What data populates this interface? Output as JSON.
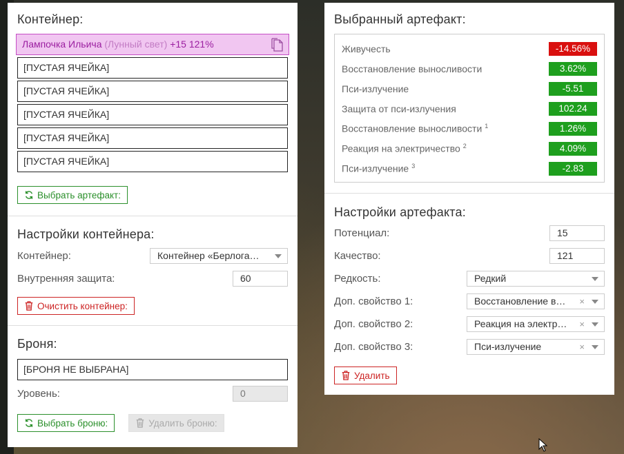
{
  "container": {
    "title": "Контейнер:",
    "artifact_name": "Лампочка Ильича",
    "artifact_sub": "(Лунный свет)",
    "artifact_stats": "+15 121%",
    "empty_cells": [
      "[ПУСТАЯ ЯЧЕЙКА]",
      "[ПУСТАЯ ЯЧЕЙКА]",
      "[ПУСТАЯ ЯЧЕЙКА]",
      "[ПУСТАЯ ЯЧЕЙКА]",
      "[ПУСТАЯ ЯЧЕЙКА]"
    ],
    "select_artifact_label": "Выбрать артефакт:"
  },
  "container_settings": {
    "title": "Настройки контейнера:",
    "container_label": "Контейнер:",
    "container_value": "Контейнер «Берлога…",
    "protection_label": "Внутренняя защита:",
    "protection_value": "60",
    "clear_label": "Очистить контейнер:"
  },
  "armor": {
    "title": "Броня:",
    "cell": "[БРОНЯ НЕ ВЫБРАНА]",
    "level_label": "Уровень:",
    "level_value": "0",
    "select_label": "Выбрать броню:",
    "delete_label": "Удалить броню:"
  },
  "selected_artifact": {
    "title": "Выбранный артефакт:",
    "stats": [
      {
        "name": "Живучесть",
        "sup": "",
        "value": "-14.56%",
        "status": "bad"
      },
      {
        "name": "Восстановление выносливости",
        "sup": "",
        "value": "3.62%",
        "status": "good"
      },
      {
        "name": "Пси-излучение",
        "sup": "",
        "value": "-5.51",
        "status": "good"
      },
      {
        "name": "Защита от пси-излучения",
        "sup": "",
        "value": "102.24",
        "status": "good"
      },
      {
        "name": "Восстановление выносливости",
        "sup": "1",
        "value": "1.26%",
        "status": "good"
      },
      {
        "name": "Реакция на электричество",
        "sup": "2",
        "value": "4.09%",
        "status": "good"
      },
      {
        "name": "Пси-излучение",
        "sup": "3",
        "value": "-2.83",
        "status": "good"
      }
    ]
  },
  "artifact_settings": {
    "title": "Настройки артефакта:",
    "potential_label": "Потенциал:",
    "potential_value": "15",
    "quality_label": "Качество:",
    "quality_value": "121",
    "rarity_label": "Редкость:",
    "rarity_value": "Редкий",
    "extra1_label": "Доп. свойство 1:",
    "extra1_value": "Восстановление в…",
    "extra2_label": "Доп. свойство 2:",
    "extra2_value": "Реакция на электр…",
    "extra3_label": "Доп. свойство 3:",
    "extra3_value": "Пси-излучение",
    "clear_symbol": "×",
    "delete_label": "Удалить"
  },
  "colors": {
    "good": "#1e9f1e",
    "bad": "#d9100f",
    "accent_green": "#2a8f2a",
    "accent_red": "#cc2222",
    "artifact_highlight": "#f1c6f1"
  }
}
